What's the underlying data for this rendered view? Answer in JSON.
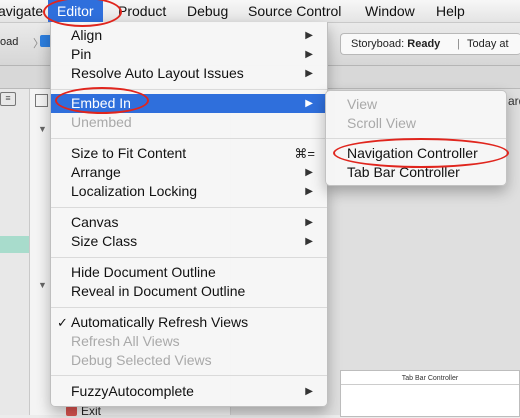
{
  "menubar": {
    "items": [
      {
        "label": "avigate"
      },
      {
        "label": "Editor"
      },
      {
        "label": "Product"
      },
      {
        "label": "Debug"
      },
      {
        "label": "Source Control"
      },
      {
        "label": "Window"
      },
      {
        "label": "Help"
      }
    ]
  },
  "toolbar": {
    "breadcrumb_fragment": "oad",
    "status_prefix": "Storyboad: ",
    "status_state": "Ready",
    "status_separator": "|",
    "status_time": "Today at"
  },
  "outline": {
    "exit_label": "Exit"
  },
  "canvas": {
    "scene_title": "Tab Bar Controller",
    "right_fragment": "ard"
  },
  "editor_menu": {
    "align": "Align",
    "pin": "Pin",
    "resolve": "Resolve Auto Layout Issues",
    "embed_in": "Embed In",
    "unembed": "Unembed",
    "size_to_fit": "Size to Fit Content",
    "size_to_fit_shortcut": "⌘=",
    "arrange": "Arrange",
    "localization_locking": "Localization Locking",
    "canvas": "Canvas",
    "size_class": "Size Class",
    "hide_outline": "Hide Document Outline",
    "reveal_outline": "Reveal in Document Outline",
    "auto_refresh": "Automatically Refresh Views",
    "auto_refresh_check": "✓",
    "refresh_all": "Refresh All Views",
    "debug_selected": "Debug Selected Views",
    "fuzzy": "FuzzyAutocomplete",
    "arrow_glyph": "▶"
  },
  "embed_submenu": {
    "view": "View",
    "scroll_view": "Scroll View",
    "navigation_controller": "Navigation Controller",
    "tab_bar_controller": "Tab Bar Controller"
  },
  "annotation_color": "#e0251d",
  "highlight_color": "#2f6fdc"
}
